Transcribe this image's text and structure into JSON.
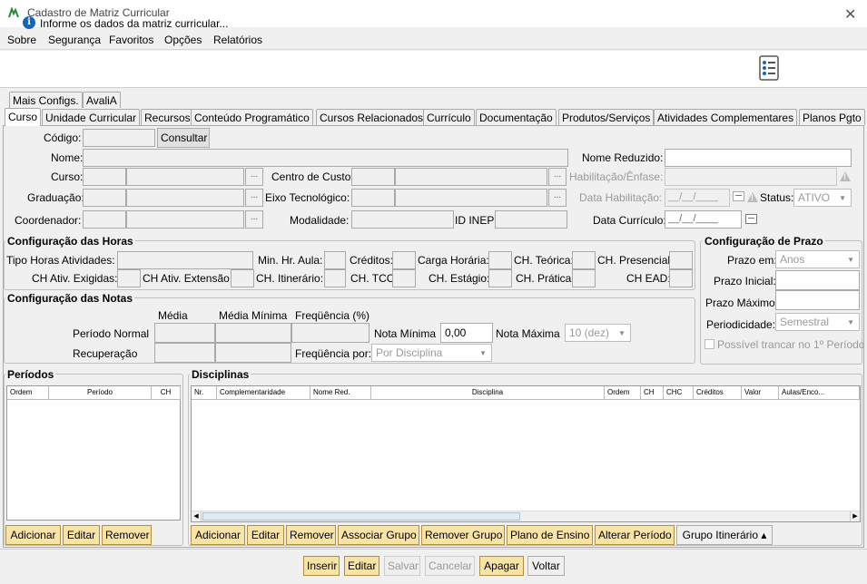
{
  "window": {
    "title": "Cadastro de Matriz Curricular"
  },
  "menu": [
    "Sobre",
    "Segurança",
    "Favoritos",
    "Opções",
    "Relatórios"
  ],
  "info": {
    "message": "Informe os dados da matriz curricular..."
  },
  "tabs_row1": [
    "Mais Configs.",
    "AvaliA"
  ],
  "tabs_row2": [
    "Curso",
    "Unidade Curricular",
    "Recursos",
    "Conteúdo Programático",
    "Cursos Relacionados",
    "Currículo",
    "Documentação",
    "Produtos/Serviços",
    "Atividades Complementares",
    "Planos Pgto"
  ],
  "form": {
    "codigo": "Código:",
    "consultar": "Consultar",
    "nome": "Nome:",
    "nome_reduzido": "Nome Reduzido:",
    "curso": "Curso:",
    "centro_custo": "Centro de Custo:",
    "habilitacao": "Habilitação/Ênfase:",
    "graduacao": "Graduação:",
    "eixo": "Eixo Tecnológico:",
    "data_habilitacao": "Data Habilitação:",
    "data_placeholder": "__/__/____",
    "status": "Status:",
    "status_value": "ATIVO",
    "coordenador": "Coordenador:",
    "modalidade": "Modalidade:",
    "id_inep": "ID INEP:",
    "data_curriculo": "Data Currículo:",
    "dots": "..."
  },
  "horas": {
    "title": "Configuração das Horas",
    "tipo_horas": "Tipo Horas Atividades:",
    "min_hr_aula": "Min. Hr. Aula:",
    "creditos": "Créditos:",
    "carga_horaria": "Carga Horária:",
    "ch_teorica": "CH. Teórica:",
    "ch_presencial": "CH. Presencial:",
    "ch_ativ_exigidas": "CH Ativ. Exigidas:",
    "ch_ativ_extensao": "CH Ativ. Extensão:",
    "ch_itinerario": "CH. Itinerário:",
    "ch_tcc": "CH. TCC:",
    "ch_estagio": "CH. Estágio:",
    "ch_pratica": "CH. Prática:",
    "ch_ead": "CH EAD:"
  },
  "prazo": {
    "title": "Configuração de Prazo",
    "prazo_em": "Prazo em:",
    "prazo_em_value": "Anos",
    "prazo_inicial": "Prazo Inicial:",
    "prazo_maximo": "Prazo Máximo:",
    "periodicidade": "Periodicidade:",
    "periodicidade_value": "Semestral",
    "trancar": "Possível trancar no 1º Período"
  },
  "notas": {
    "title": "Configuração das Notas",
    "media": "Média",
    "media_minima": "Média Mínima",
    "frequencia": "Freqüência (%)",
    "periodo_normal": "Período Normal",
    "recuperacao": "Recuperação",
    "nota_minima": "Nota Mínima",
    "nota_minima_value": "0,00",
    "nota_maxima": "Nota Máxima",
    "nota_maxima_value": "10 (dez)",
    "frequencia_por": "Freqüência por:",
    "frequencia_por_value": "Por Disciplina"
  },
  "periodos": {
    "title": "Períodos",
    "columns": [
      "Ordem",
      "Período",
      "CH"
    ],
    "buttons": [
      "Adicionar",
      "Editar",
      "Remover"
    ]
  },
  "disciplinas": {
    "title": "Disciplinas",
    "columns": [
      "Nr.",
      "Complementaridade",
      "Nome Red.",
      "Disciplina",
      "Ordem",
      "CH",
      "CHC",
      "Créditos",
      "Valor",
      "Aulas/Enco..."
    ],
    "buttons": [
      "Adicionar",
      "Editar",
      "Remover",
      "Associar Grupo",
      "Remover Grupo",
      "Plano de Ensino",
      "Alterar Período",
      "Grupo Itinerário ▴"
    ]
  },
  "bottom": {
    "buttons": [
      "Inserir",
      "Editar",
      "Salvar",
      "Cancelar",
      "Apagar",
      "Voltar"
    ]
  }
}
